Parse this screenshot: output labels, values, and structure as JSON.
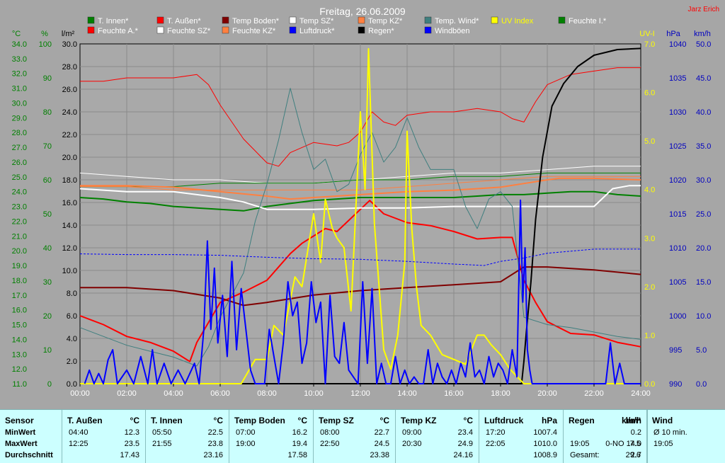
{
  "title": "Freitag, 26.06.2009",
  "author": "Jarz Erich",
  "colors": {
    "bg": "#a6a6a6",
    "plot": "#a9a9a9",
    "grid": "#8a8a8a",
    "green_axis": "#008000",
    "blue_axis": "#0000c0",
    "yellow": "#ffff00",
    "white": "#ffffff",
    "red": "#ff0000",
    "darkred": "#800000",
    "orange": "#ff8040",
    "teal": "#3f7f7f",
    "black": "#000000",
    "blue": "#0000ff",
    "greenline": "#007f00"
  },
  "legend": [
    {
      "label": "T. Innen*",
      "color": "#008000"
    },
    {
      "label": "T. Außen*",
      "color": "#ff0000"
    },
    {
      "label": "Temp Boden*",
      "color": "#800000"
    },
    {
      "label": "Temp SZ*",
      "color": "#ffffff"
    },
    {
      "label": "Temp KZ*",
      "color": "#ff8040"
    },
    {
      "label": "Temp. Wind*",
      "color": "#3f7f7f"
    },
    {
      "label": "UV Index",
      "color": "#ffff00",
      "textColor": "#ffff00"
    },
    {
      "label": "Feuchte I.*",
      "color": "#008000"
    },
    {
      "label": "Feuchte A.*",
      "color": "#ff0000"
    },
    {
      "label": "Feuchte SZ*",
      "color": "#ffffff"
    },
    {
      "label": "Feuchte KZ*",
      "color": "#ff8040"
    },
    {
      "label": "Luftdruck*",
      "color": "#0000ff"
    },
    {
      "label": "Regen*",
      "color": "#000000"
    },
    {
      "label": "Windböen",
      "color": "#0000ff"
    }
  ],
  "axis_units": {
    "temp": "°C",
    "pct": "%",
    "rain": "l/m²",
    "uv": "UV-I",
    "hpa": "hPa",
    "kmh": "km/h"
  },
  "stats": {
    "row_labels": {
      "sensor": "Sensor",
      "min": "MinWert",
      "max": "MaxWert",
      "avg": "Durchschnitt"
    },
    "columns": [
      {
        "name": "T. Außen",
        "unit": "°C",
        "min_t": "04:40",
        "min_v": "12.3",
        "max_t": "12:25",
        "max_v": "23.5",
        "avg": "17.43"
      },
      {
        "name": "T. Innen",
        "unit": "°C",
        "min_t": "05:50",
        "min_v": "22.5",
        "max_t": "21:55",
        "max_v": "23.8",
        "avg": "23.16"
      },
      {
        "name": "Temp Boden",
        "unit": "°C",
        "min_t": "07:00",
        "min_v": "16.2",
        "max_t": "19:00",
        "max_v": "19.4",
        "avg": "17.58"
      },
      {
        "name": "Temp SZ",
        "unit": "°C",
        "min_t": "08:00",
        "min_v": "22.7",
        "max_t": "22:50",
        "max_v": "24.5",
        "avg": "23.38"
      },
      {
        "name": "Temp KZ",
        "unit": "°C",
        "min_t": "09:00",
        "min_v": "23.4",
        "max_t": "20:30",
        "max_v": "24.9",
        "avg": "24.16"
      },
      {
        "name": "Luftdruck",
        "unit": "hPa",
        "min_t": "17:20",
        "min_v": "1007.4",
        "max_t": "22:05",
        "max_v": "1010.0",
        "avg": "1008.9"
      },
      {
        "name": "Regen",
        "unit": "l/m²",
        "min_t": "",
        "min_v": "",
        "max_t": "19:05",
        "max_v": "7.5",
        "avg_label": "Gesamt:",
        "avg": "29.6"
      },
      {
        "name": "Wind",
        "unit": "km/h",
        "min_t": "Ø 10 min.",
        "min_v": "0.2",
        "max_t": "19:05",
        "max_v": "0-NO 14.0",
        "avg": "2.7"
      }
    ]
  },
  "chart_data": {
    "type": "line",
    "title": "Freitag, 26.06.2009",
    "x_ticks": [
      "00:00",
      "02:00",
      "04:00",
      "06:00",
      "08:00",
      "10:00",
      "12:00",
      "14:00",
      "16:00",
      "18:00",
      "20:00",
      "22:00",
      "24:00"
    ],
    "xlim": [
      0,
      24
    ],
    "axes": {
      "temp": {
        "unit": "°C",
        "ylim": [
          11,
          34
        ],
        "ticks": [
          "34.0",
          "33.0",
          "32.0",
          "31.0",
          "30.0",
          "29.0",
          "28.0",
          "27.0",
          "26.0",
          "25.0",
          "24.0",
          "23.0",
          "22.0",
          "21.0",
          "20.0",
          "19.0",
          "18.0",
          "17.0",
          "16.0",
          "15.0",
          "14.0",
          "13.0",
          "12.0",
          "11.0"
        ]
      },
      "pct": {
        "unit": "%",
        "ylim": [
          0,
          100
        ],
        "ticks": [
          "100",
          "90",
          "80",
          "70",
          "60",
          "50",
          "40",
          "30",
          "20",
          "10",
          "0"
        ]
      },
      "rain": {
        "unit": "l/m²",
        "ylim": [
          0,
          30
        ],
        "ticks": [
          "30.0",
          "28.0",
          "26.0",
          "24.0",
          "22.0",
          "20.0",
          "18.0",
          "16.0",
          "14.0",
          "12.0",
          "10.0",
          "8.0",
          "6.0",
          "4.0",
          "2.0",
          "0.0"
        ]
      },
      "uv": {
        "unit": "UV-I",
        "ylim": [
          0,
          7
        ],
        "ticks": [
          "7.0",
          "6.0",
          "5.0",
          "4.0",
          "3.0",
          "2.0",
          "1.0",
          "0.0"
        ]
      },
      "hpa": {
        "unit": "hPa",
        "ylim": [
          990,
          1040
        ],
        "ticks": [
          "1040",
          "1035",
          "1030",
          "1025",
          "1020",
          "1015",
          "1010",
          "1005",
          "1000",
          "995",
          "990"
        ]
      },
      "kmh": {
        "unit": "km/h",
        "ylim": [
          0,
          50
        ],
        "ticks": [
          "50.0",
          "45.0",
          "40.0",
          "35.0",
          "30.0",
          "25.0",
          "20.0",
          "15.0",
          "10.0",
          "5.0",
          "0.0"
        ]
      }
    },
    "series": [
      {
        "name": "Feuchte A.*",
        "axis": "pct",
        "color": "#ff0000",
        "width": 1,
        "x": [
          0,
          1,
          2,
          3,
          4,
          5,
          5.5,
          6,
          7,
          8,
          8.5,
          9,
          10,
          11,
          11.5,
          12,
          12.5,
          13,
          13.5,
          14,
          15,
          16,
          17,
          18,
          18.5,
          19,
          19.5,
          20,
          21,
          22,
          23,
          24
        ],
        "y": [
          89,
          89,
          90,
          90,
          90,
          91,
          88,
          82,
          72,
          65,
          64,
          68,
          71,
          70,
          71,
          74,
          80,
          77,
          76,
          79,
          80,
          80,
          81,
          80,
          78,
          77,
          83,
          88,
          91,
          92,
          93,
          93
        ]
      },
      {
        "name": "Feuchte SZ*",
        "axis": "pct",
        "color": "#ffffff",
        "width": 1,
        "x": [
          0,
          2,
          4,
          6,
          8,
          10,
          12,
          14,
          16,
          18,
          20,
          22,
          24
        ],
        "y": [
          62,
          61,
          60,
          60,
          59,
          59,
          60,
          61,
          62,
          62,
          63,
          64,
          64
        ]
      },
      {
        "name": "Feuchte I.*",
        "axis": "pct",
        "color": "#008000",
        "width": 1,
        "x": [
          0,
          2,
          4,
          6,
          8,
          10,
          12,
          14,
          16,
          18,
          20,
          22,
          24
        ],
        "y": [
          58,
          58,
          58,
          59,
          59,
          59,
          60,
          60,
          61,
          61,
          62,
          62,
          62
        ]
      },
      {
        "name": "Feuchte KZ*",
        "axis": "pct",
        "color": "#ff8040",
        "width": 1,
        "x": [
          0,
          2,
          4,
          6,
          8,
          10,
          12,
          14,
          16,
          18,
          20,
          22,
          24
        ],
        "y": [
          58,
          58,
          57,
          57,
          57,
          57,
          57,
          58,
          59,
          60,
          61,
          61,
          61
        ]
      },
      {
        "name": "T. Innen*",
        "axis": "temp",
        "color": "#008000",
        "width": 2,
        "x": [
          0,
          1,
          2,
          3,
          4,
          5,
          6,
          7,
          8,
          9,
          10,
          11,
          12,
          13,
          14,
          15,
          16,
          17,
          18,
          19,
          20,
          21,
          22,
          23,
          24
        ],
        "y": [
          23.6,
          23.5,
          23.3,
          23.2,
          23.0,
          22.9,
          22.8,
          22.7,
          23.0,
          23.2,
          23.4,
          23.5,
          23.6,
          23.6,
          23.6,
          23.6,
          23.6,
          23.7,
          23.8,
          23.8,
          23.9,
          24.0,
          24.0,
          23.8,
          23.7
        ]
      },
      {
        "name": "T. Außen*",
        "axis": "temp",
        "color": "#ff0000",
        "width": 2,
        "x": [
          0,
          1,
          2,
          3,
          4,
          4.7,
          5,
          6,
          7,
          8,
          9,
          9.5,
          10,
          10.5,
          11,
          12,
          12.4,
          13,
          14,
          15,
          16,
          17,
          18,
          18.5,
          19,
          19.5,
          20,
          21,
          22,
          23,
          24
        ],
        "y": [
          15.6,
          15.0,
          14.2,
          13.8,
          13.2,
          12.5,
          13.8,
          16.5,
          17.2,
          18.0,
          19.8,
          20.5,
          21.0,
          21.5,
          21.3,
          22.8,
          23.4,
          22.5,
          21.9,
          21.7,
          21.3,
          20.8,
          20.9,
          20.9,
          18.0,
          16.5,
          15.2,
          14.4,
          14.3,
          13.8,
          13.5
        ]
      },
      {
        "name": "Temp Boden*",
        "axis": "temp",
        "color": "#800000",
        "width": 2,
        "x": [
          0,
          2,
          4,
          6,
          7,
          8,
          10,
          12,
          14,
          16,
          18,
          19,
          20,
          22,
          24
        ],
        "y": [
          17.5,
          17.5,
          17.3,
          16.8,
          16.3,
          16.5,
          17.0,
          17.3,
          17.5,
          17.7,
          17.9,
          18.9,
          18.9,
          18.7,
          18.4
        ]
      },
      {
        "name": "Temp SZ*",
        "axis": "temp",
        "color": "#ffffff",
        "width": 2,
        "x": [
          0,
          2,
          4,
          6,
          7,
          8,
          10,
          12,
          14,
          16,
          18,
          20,
          22,
          22.8,
          23.5,
          24
        ],
        "y": [
          24.2,
          24.0,
          24.0,
          23.6,
          23.3,
          22.8,
          22.8,
          22.9,
          22.9,
          23.0,
          23.0,
          23.0,
          23.0,
          24.2,
          24.4,
          24.4
        ]
      },
      {
        "name": "Temp KZ*",
        "axis": "temp",
        "color": "#ff8040",
        "width": 2,
        "x": [
          0,
          2,
          4,
          6,
          8,
          9,
          10,
          12,
          14,
          16,
          18,
          20,
          20.5,
          22,
          24
        ],
        "y": [
          24.4,
          24.4,
          24.3,
          24.0,
          23.7,
          23.5,
          23.6,
          23.8,
          24.0,
          24.1,
          24.3,
          24.8,
          24.9,
          24.9,
          24.8
        ]
      },
      {
        "name": "Temp. Wind*",
        "axis": "temp",
        "color": "#3f7f7f",
        "width": 1,
        "x": [
          0,
          1,
          2,
          3,
          4,
          5,
          5.5,
          6,
          7,
          7.5,
          8,
          8.5,
          9,
          9.5,
          10,
          10.5,
          11,
          11.5,
          12,
          12.5,
          13,
          13.5,
          14,
          14.5,
          15,
          16,
          16.5,
          17,
          17.5,
          18,
          18.5,
          19,
          20,
          21,
          22,
          23,
          24
        ],
        "y": [
          14.8,
          14.2,
          13.6,
          13.2,
          12.8,
          12.2,
          13.5,
          15.5,
          18.5,
          22.0,
          24.5,
          27.5,
          31.0,
          28.0,
          25.5,
          26.2,
          24.0,
          24.5,
          26.5,
          28.0,
          26.0,
          27.0,
          29.0,
          27.0,
          25.5,
          25.5,
          23.0,
          21.5,
          23.5,
          24.0,
          23.0,
          15.5,
          15.0,
          14.8,
          14.5,
          14.2,
          14.0
        ]
      },
      {
        "name": "Regen*",
        "axis": "rain",
        "color": "#000000",
        "width": 2,
        "x": [
          0,
          18.9,
          19.0,
          19.1,
          19.3,
          19.5,
          19.8,
          20.2,
          20.7,
          21.3,
          22,
          23,
          24
        ],
        "y": [
          0,
          0,
          2.0,
          4.5,
          9.0,
          14.5,
          20.0,
          24.5,
          26.5,
          28.0,
          29.0,
          29.5,
          29.6
        ]
      },
      {
        "name": "UV Index",
        "axis": "uv",
        "color": "#ffff00",
        "width": 2,
        "x": [
          0,
          6.9,
          7.5,
          8.0,
          8.3,
          8.7,
          9.2,
          9.5,
          10.0,
          10.3,
          10.5,
          10.8,
          11.0,
          11.3,
          11.6,
          12.0,
          12.2,
          12.35,
          12.6,
          13.0,
          13.3,
          13.6,
          13.9,
          14.0,
          14.2,
          14.4,
          14.6,
          15.0,
          15.5,
          16.0,
          16.5,
          17.0,
          17.3,
          17.6,
          18.0,
          18.4,
          19.0,
          24
        ],
        "y": [
          0,
          0,
          0.5,
          0.5,
          1.2,
          1.0,
          2.2,
          2.0,
          3.5,
          2.5,
          3.8,
          3.2,
          3.0,
          2.8,
          1.5,
          5.6,
          4.0,
          6.9,
          3.3,
          0.7,
          0.3,
          1.0,
          2.5,
          5.2,
          3.2,
          2.0,
          1.2,
          1.0,
          0.6,
          0.5,
          0.4,
          1.0,
          1.0,
          0.8,
          0.6,
          0.3,
          0,
          0
        ]
      },
      {
        "name": "Luftdruck*",
        "axis": "hpa",
        "color": "#0000ff",
        "width": 1,
        "dashed": true,
        "x": [
          0,
          2,
          4,
          6,
          8,
          10,
          12,
          14,
          16,
          17.3,
          18,
          19,
          20,
          22,
          24
        ],
        "y": [
          1009.1,
          1009.0,
          1009.0,
          1008.9,
          1008.6,
          1008.4,
          1008.3,
          1008.0,
          1007.6,
          1007.4,
          1008.0,
          1008.5,
          1009.2,
          1009.8,
          1009.8
        ]
      },
      {
        "name": "Windböen",
        "axis": "kmh",
        "color": "#0000ff",
        "width": 2,
        "x": [
          0.2,
          0.4,
          0.6,
          0.8,
          1.0,
          1.2,
          1.4,
          1.6,
          2.0,
          2.3,
          2.6,
          2.9,
          3.1,
          3.3,
          3.6,
          3.9,
          4.2,
          4.5,
          4.7,
          4.9,
          5.1,
          5.3,
          5.45,
          5.6,
          5.75,
          5.9,
          6.1,
          6.3,
          6.5,
          6.7,
          6.9,
          7.1,
          7.3,
          7.5,
          7.7,
          7.9,
          8.1,
          8.3,
          8.5,
          8.7,
          8.9,
          9.1,
          9.3,
          9.5,
          9.7,
          9.9,
          10.1,
          10.3,
          10.5,
          10.7,
          10.9,
          11.1,
          11.3,
          11.5,
          11.7,
          11.9,
          12.1,
          12.3,
          12.5,
          12.7,
          12.9,
          13.1,
          13.3,
          13.5,
          13.7,
          13.9,
          14.1,
          14.3,
          14.5,
          14.7,
          14.9,
          15.1,
          15.3,
          15.5,
          15.7,
          15.9,
          16.1,
          16.3,
          16.5,
          16.7,
          16.9,
          17.1,
          17.3,
          17.5,
          17.7,
          17.9,
          18.1,
          18.3,
          18.5,
          18.7,
          18.85,
          18.95,
          19.05,
          19.15,
          19.25,
          19.35,
          19.5,
          19.7,
          20,
          22.5,
          22.7,
          22.9,
          23.1,
          23.3,
          23.5,
          23.7,
          24
        ],
        "y": [
          0,
          2,
          0,
          1.5,
          0,
          3.5,
          5,
          0,
          2,
          0,
          4,
          0,
          5,
          0,
          3,
          0,
          2,
          0,
          1.5,
          3,
          0,
          8,
          21,
          8,
          17,
          6,
          13,
          4,
          18,
          5,
          14,
          8,
          2,
          0,
          0,
          0,
          8,
          4,
          0,
          6,
          15,
          10,
          12,
          3,
          6,
          15,
          9,
          12,
          0,
          13,
          4,
          3,
          9,
          2,
          1,
          0,
          15,
          3,
          14,
          0,
          3,
          0,
          0,
          4,
          0,
          2,
          0,
          1,
          0,
          0,
          5,
          0,
          3,
          1,
          0,
          2,
          0,
          3,
          1,
          6,
          1,
          2,
          0,
          4,
          1,
          3,
          2,
          0,
          5,
          1,
          27,
          12,
          20,
          5,
          2,
          0,
          0,
          0,
          0,
          0,
          6,
          0,
          3,
          0,
          0,
          0,
          0
        ]
      }
    ]
  }
}
